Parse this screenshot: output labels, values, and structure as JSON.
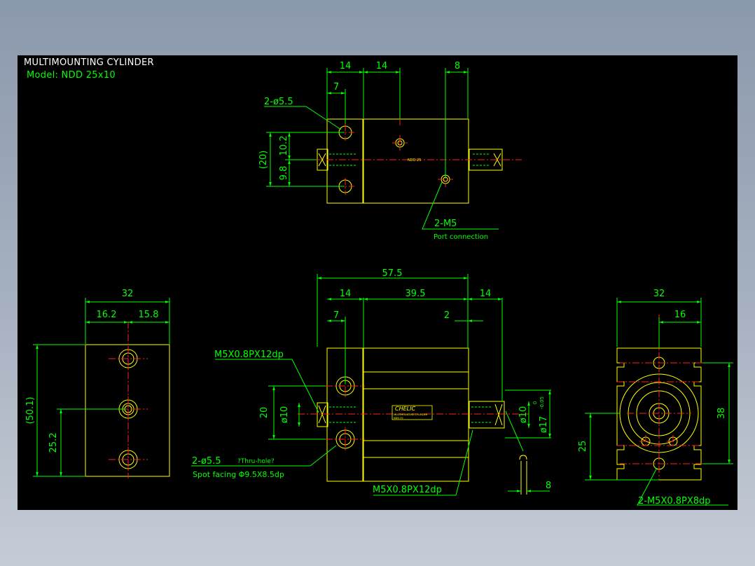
{
  "header": {
    "title": "MULTIMOUNTING CYLINDER",
    "model": "Model: NDD 25x10"
  },
  "colors": {
    "outline": "#ffff00",
    "dimension": "#00ff00",
    "center_line": "#ff2020",
    "hole": "#ff2020",
    "background": "#000000"
  },
  "top_view": {
    "dims": {
      "w14a": "14",
      "w14b": "14",
      "w8": "8",
      "w7": "7",
      "h20": "(20)",
      "h10_2": "10.2",
      "h9_8": "9.8"
    },
    "hole_label": "2-ø5.5",
    "port_label": "2-M5",
    "port_note": "Port connection",
    "nameplate": "NDD 25"
  },
  "left_view": {
    "dims": {
      "w32": "32",
      "w16_2": "16.2",
      "w15_8": "15.8",
      "h50_1": "(50.1)",
      "h25_2": "25.2"
    }
  },
  "front_view": {
    "dims": {
      "w57_5": "57.5",
      "w14a": "14",
      "w39_5": "39.5",
      "w14b": "14",
      "w7": "7",
      "w2": "2",
      "h20": "20",
      "d10a": "ø10",
      "d10b": "ø10",
      "d17": "ø17",
      "tol_upper": "0",
      "tol_lower": "-0.05",
      "w8": "8"
    },
    "thread_top": "M5X0.8PX12dp",
    "thread_bottom": "M5X0.8PX12dp",
    "hole_label": "2-ø5.5",
    "thru_note": "?Thru-hole?",
    "spot_note": "Spot facing  Φ9.5X8.5dp",
    "logo": "CHELIC",
    "logo_sub": "MULTIMOUNTING CYLINDER",
    "logo_model": "NDD 25"
  },
  "right_view": {
    "dims": {
      "w32": "32",
      "w16": "16",
      "h38": "38",
      "h25": "25"
    },
    "thread_label": "2-M5X0.8PX8dp"
  }
}
